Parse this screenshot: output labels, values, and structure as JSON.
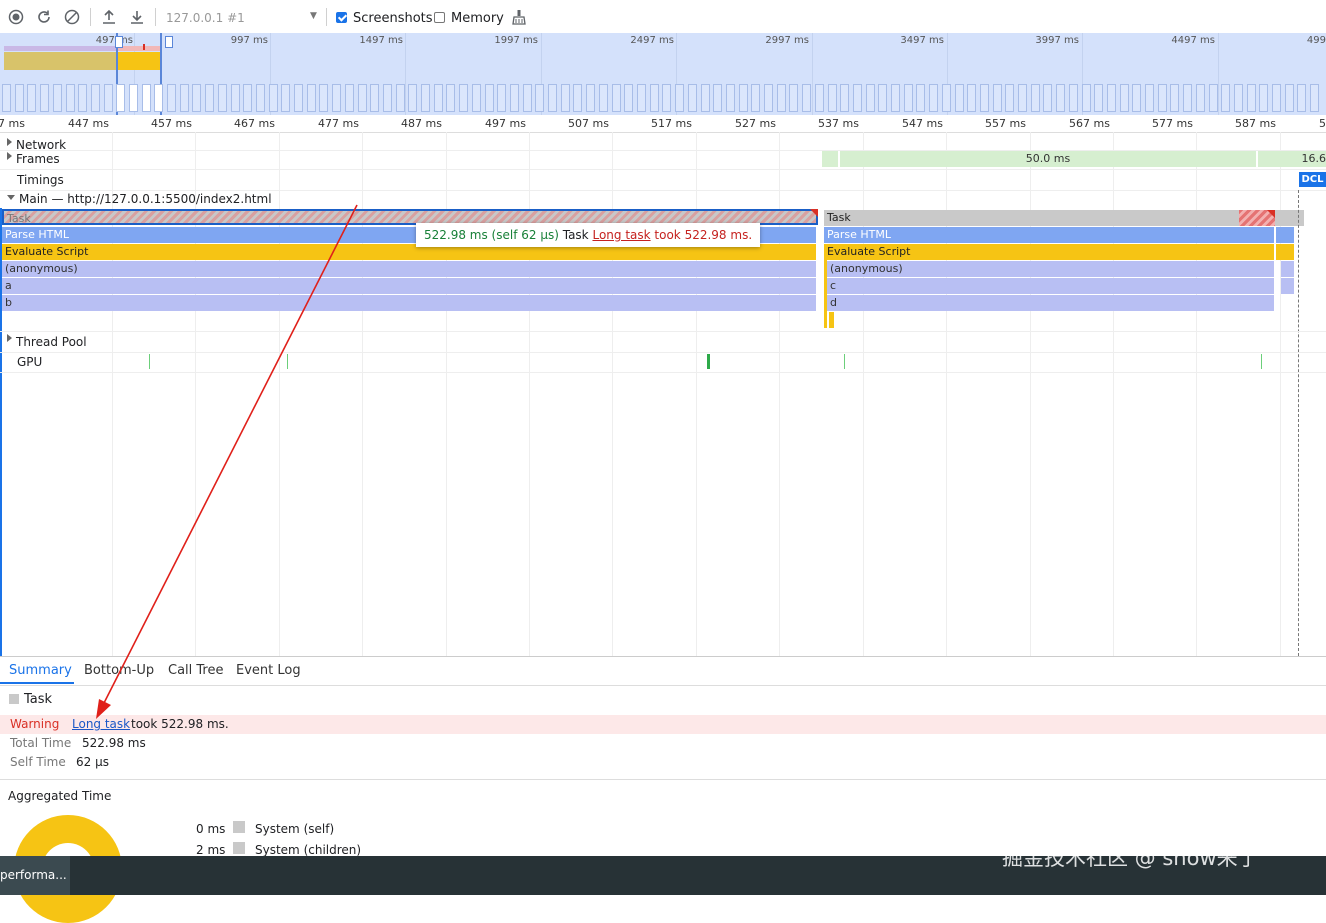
{
  "toolbar": {
    "target": "127.0.0.1 #1",
    "screenshots_label": "Screenshots",
    "screenshots_checked": true,
    "memory_label": "Memory",
    "memory_checked": false,
    "icons": [
      "record-icon",
      "reload-icon",
      "clear-icon",
      "upload-icon",
      "download-icon",
      "dropdown-arrow-icon",
      "broom-icon"
    ]
  },
  "overview": {
    "labels": [
      "497 ms",
      "997 ms",
      "1497 ms",
      "1997 ms",
      "2497 ms",
      "2997 ms",
      "3497 ms",
      "3997 ms",
      "4497 ms",
      "499"
    ]
  },
  "ruler": {
    "labels": [
      "7 ms",
      "447 ms",
      "457 ms",
      "467 ms",
      "477 ms",
      "487 ms",
      "497 ms",
      "507 ms",
      "517 ms",
      "527 ms",
      "537 ms",
      "547 ms",
      "557 ms",
      "567 ms",
      "577 ms",
      "587 ms",
      "5"
    ]
  },
  "tracks": {
    "network": "Network",
    "frames": "Frames",
    "frame_duration": "50.0 ms",
    "frame_duration2": "16.6",
    "timings": "Timings",
    "dcl": "DCL",
    "main": "Main — http://127.0.0.1:5500/index2.html",
    "thread_pool": "Thread Pool",
    "gpu": "GPU"
  },
  "flame": {
    "left": [
      "Task",
      "Parse HTML",
      "Evaluate Script",
      "(anonymous)",
      "a",
      "b"
    ],
    "right": [
      "Task",
      "Parse HTML",
      "Evaluate Script",
      "(anonymous)",
      "c",
      "d"
    ]
  },
  "tooltip": {
    "duration": "522.98 ms (self 62 μs)",
    "name": "Task",
    "link": "Long task",
    "rest": "took 522.98 ms."
  },
  "bottom_tabs": [
    "Summary",
    "Bottom-Up",
    "Call Tree",
    "Event Log"
  ],
  "summary": {
    "title": "Task",
    "warning_label": "Warning",
    "warning_link": "Long task",
    "warning_rest": "took 522.98 ms.",
    "total_time_label": "Total Time",
    "total_time": "522.98 ms",
    "self_time_label": "Self Time",
    "self_time": "62 μs",
    "aggregated": "Aggregated Time",
    "legend": [
      {
        "value": "0 ms",
        "label": "System (self)"
      },
      {
        "value": "2 ms",
        "label": "System (children)"
      }
    ]
  },
  "taskbar": {
    "item": "performa..."
  },
  "watermark": "掘金技术社区 @ snow来了",
  "colors": {
    "accent": "#1a73e8",
    "task": "#c9c9c9",
    "parse_html": "#7fa6f2",
    "evaluate_script": "#f6c414",
    "anonymous": "#b8bff3",
    "warning_bg": "#fde8e8",
    "warning_text": "#d93025",
    "arrow": "#e0201a"
  }
}
